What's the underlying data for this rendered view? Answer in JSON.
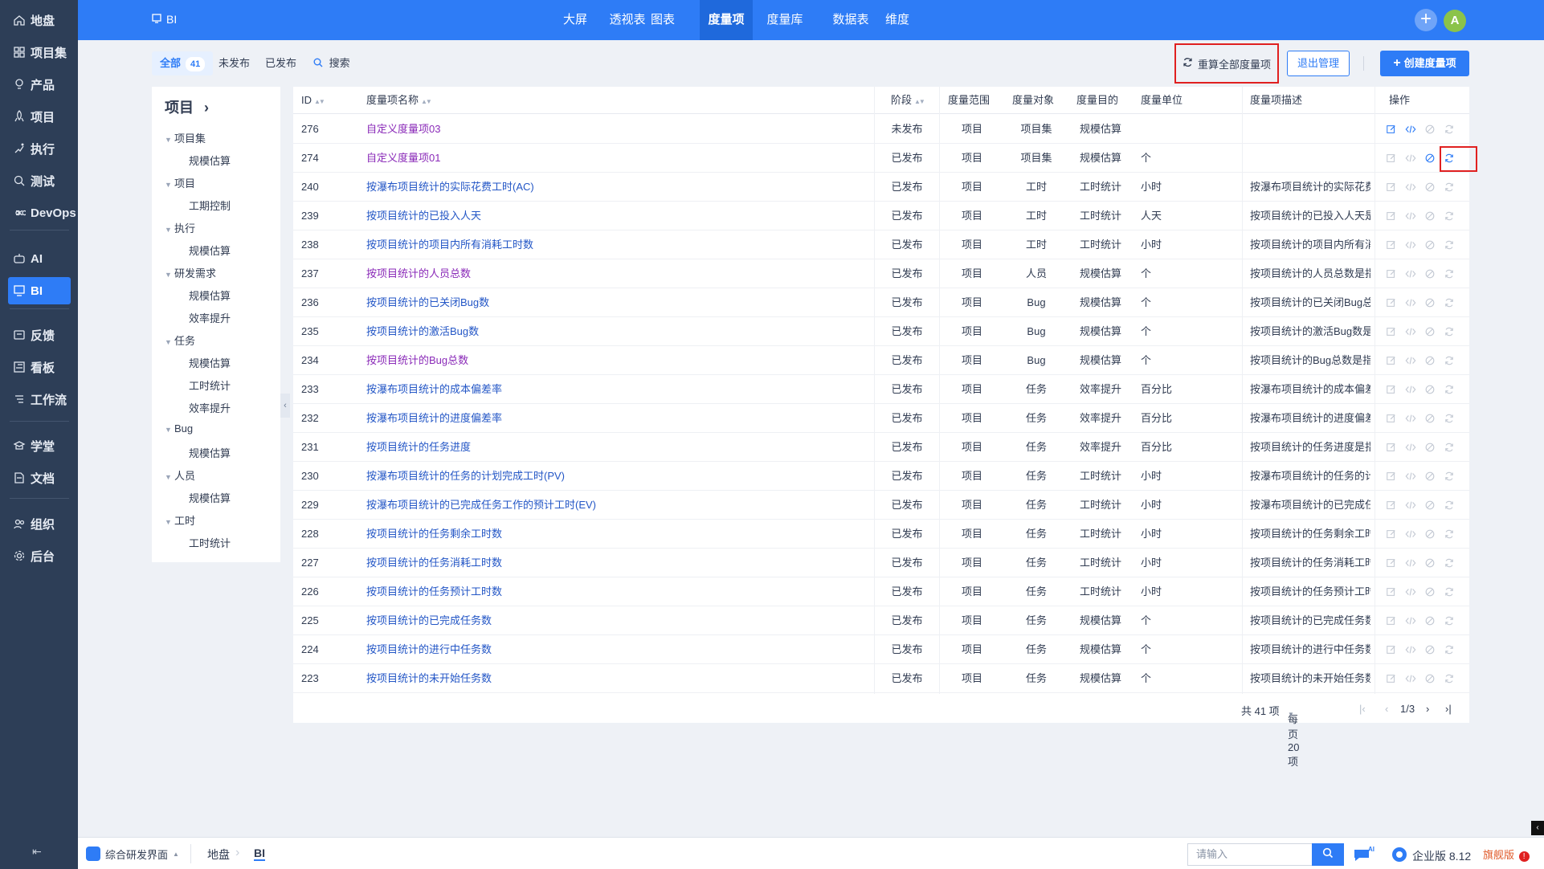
{
  "nav": {
    "items": [
      {
        "label": "地盘",
        "icon": "home-icon"
      },
      {
        "label": "项目集",
        "icon": "grid-icon"
      },
      {
        "label": "产品",
        "icon": "lightbulb-icon"
      },
      {
        "label": "项目",
        "icon": "rocket-icon"
      },
      {
        "label": "执行",
        "icon": "run-icon"
      },
      {
        "label": "测试",
        "icon": "search-icon"
      },
      {
        "label": "DevOps",
        "icon": "infinity-icon"
      },
      {
        "label": "AI",
        "icon": "robot-icon"
      },
      {
        "label": "BI",
        "icon": "chart-icon"
      },
      {
        "label": "反馈",
        "icon": "feedback-icon"
      },
      {
        "label": "看板",
        "icon": "kanban-icon"
      },
      {
        "label": "工作流",
        "icon": "workflow-icon"
      },
      {
        "label": "学堂",
        "icon": "school-icon"
      },
      {
        "label": "文档",
        "icon": "doc-icon"
      },
      {
        "label": "组织",
        "icon": "people-icon"
      },
      {
        "label": "后台",
        "icon": "gear-icon"
      }
    ],
    "active": "BI",
    "collapse": "⇤"
  },
  "header": {
    "app_title": "BI",
    "tabs": [
      "大屏",
      "透视表",
      "图表",
      "度量项",
      "度量库",
      "数据表",
      "维度"
    ],
    "active_tab": "度量项",
    "avatar": "A",
    "plus": "+"
  },
  "toolbar": {
    "tabs": [
      {
        "label": "全部",
        "count": "41"
      },
      {
        "label": "未发布"
      },
      {
        "label": "已发布"
      }
    ],
    "search": "搜索",
    "recalc": "重算全部度量项",
    "exit": "退出管理",
    "create": "创建度量项"
  },
  "tree": {
    "title": "项目",
    "arrow": "›",
    "groups": [
      {
        "label": "项目集",
        "children": [
          "规模估算"
        ]
      },
      {
        "label": "项目",
        "children": [
          "工期控制"
        ]
      },
      {
        "label": "执行",
        "children": [
          "规模估算"
        ]
      },
      {
        "label": "研发需求",
        "children": [
          "规模估算",
          "效率提升"
        ]
      },
      {
        "label": "任务",
        "children": [
          "规模估算",
          "工时统计",
          "效率提升"
        ]
      },
      {
        "label": "Bug",
        "children": [
          "规模估算"
        ]
      },
      {
        "label": "人员",
        "children": [
          "规模估算"
        ]
      },
      {
        "label": "工时",
        "children": [
          "工时统计"
        ]
      }
    ]
  },
  "table": {
    "columns": [
      "ID",
      "度量项名称",
      "阶段",
      "度量范围",
      "度量对象",
      "度量目的",
      "度量单位",
      "度量项描述",
      "操作"
    ],
    "rows": [
      {
        "id": "276",
        "name": "自定义度量项03",
        "visited": true,
        "stage": "未发布",
        "scope": "项目",
        "object": "项目集",
        "purpose": "规模估算",
        "unit": "",
        "desc": ""
      },
      {
        "id": "274",
        "name": "自定义度量项01",
        "visited": true,
        "stage": "已发布",
        "scope": "项目",
        "object": "项目集",
        "purpose": "规模估算",
        "unit": "个",
        "desc": ""
      },
      {
        "id": "240",
        "name": "按瀑布项目统计的实际花费工时(AC)",
        "stage": "已发布",
        "scope": "项目",
        "object": "工时",
        "purpose": "工时统计",
        "unit": "小时",
        "desc": "按瀑布项目统计的实际花费"
      },
      {
        "id": "239",
        "name": "按项目统计的已投入人天",
        "stage": "已发布",
        "scope": "项目",
        "object": "工时",
        "purpose": "工时统计",
        "unit": "人天",
        "desc": "按项目统计的已投入人天是"
      },
      {
        "id": "238",
        "name": "按项目统计的项目内所有消耗工时数",
        "stage": "已发布",
        "scope": "项目",
        "object": "工时",
        "purpose": "工时统计",
        "unit": "小时",
        "desc": "按项目统计的项目内所有消"
      },
      {
        "id": "237",
        "name": "按项目统计的人员总数",
        "visited": true,
        "stage": "已发布",
        "scope": "项目",
        "object": "人员",
        "purpose": "规模估算",
        "unit": "个",
        "desc": "按项目统计的人员总数是指"
      },
      {
        "id": "236",
        "name": "按项目统计的已关闭Bug数",
        "stage": "已发布",
        "scope": "项目",
        "object": "Bug",
        "purpose": "规模估算",
        "unit": "个",
        "desc": "按项目统计的已关闭Bug总"
      },
      {
        "id": "235",
        "name": "按项目统计的激活Bug数",
        "stage": "已发布",
        "scope": "项目",
        "object": "Bug",
        "purpose": "规模估算",
        "unit": "个",
        "desc": "按项目统计的激活Bug数是"
      },
      {
        "id": "234",
        "name": "按项目统计的Bug总数",
        "visited": true,
        "stage": "已发布",
        "scope": "项目",
        "object": "Bug",
        "purpose": "规模估算",
        "unit": "个",
        "desc": "按项目统计的Bug总数是指"
      },
      {
        "id": "233",
        "name": "按瀑布项目统计的成本偏差率",
        "stage": "已发布",
        "scope": "项目",
        "object": "任务",
        "purpose": "效率提升",
        "unit": "百分比",
        "desc": "按瀑布项目统计的成本偏差"
      },
      {
        "id": "232",
        "name": "按瀑布项目统计的进度偏差率",
        "stage": "已发布",
        "scope": "项目",
        "object": "任务",
        "purpose": "效率提升",
        "unit": "百分比",
        "desc": "按瀑布项目统计的进度偏差"
      },
      {
        "id": "231",
        "name": "按项目统计的任务进度",
        "stage": "已发布",
        "scope": "项目",
        "object": "任务",
        "purpose": "效率提升",
        "unit": "百分比",
        "desc": "按项目统计的任务进度是指"
      },
      {
        "id": "230",
        "name": "按瀑布项目统计的任务的计划完成工时(PV)",
        "stage": "已发布",
        "scope": "项目",
        "object": "任务",
        "purpose": "工时统计",
        "unit": "小时",
        "desc": "按瀑布项目统计的任务的计"
      },
      {
        "id": "229",
        "name": "按瀑布项目统计的已完成任务工作的预计工时(EV)",
        "stage": "已发布",
        "scope": "项目",
        "object": "任务",
        "purpose": "工时统计",
        "unit": "小时",
        "desc": "按瀑布项目统计的已完成任"
      },
      {
        "id": "228",
        "name": "按项目统计的任务剩余工时数",
        "stage": "已发布",
        "scope": "项目",
        "object": "任务",
        "purpose": "工时统计",
        "unit": "小时",
        "desc": "按项目统计的任务剩余工时"
      },
      {
        "id": "227",
        "name": "按项目统计的任务消耗工时数",
        "stage": "已发布",
        "scope": "项目",
        "object": "任务",
        "purpose": "工时统计",
        "unit": "小时",
        "desc": "按项目统计的任务消耗工时"
      },
      {
        "id": "226",
        "name": "按项目统计的任务预计工时数",
        "stage": "已发布",
        "scope": "项目",
        "object": "任务",
        "purpose": "工时统计",
        "unit": "小时",
        "desc": "按项目统计的任务预计工时"
      },
      {
        "id": "225",
        "name": "按项目统计的已完成任务数",
        "stage": "已发布",
        "scope": "项目",
        "object": "任务",
        "purpose": "规模估算",
        "unit": "个",
        "desc": "按项目统计的已完成任务数"
      },
      {
        "id": "224",
        "name": "按项目统计的进行中任务数",
        "stage": "已发布",
        "scope": "项目",
        "object": "任务",
        "purpose": "规模估算",
        "unit": "个",
        "desc": "按项目统计的进行中任务数"
      },
      {
        "id": "223",
        "name": "按项目统计的未开始任务数",
        "stage": "已发布",
        "scope": "项目",
        "object": "任务",
        "purpose": "规模估算",
        "unit": "个",
        "desc": "按项目统计的未开始任务数"
      }
    ]
  },
  "pager": {
    "total": "共 41 项",
    "per_page": "每页 20 项",
    "page": "1/3",
    "first": "|‹",
    "prev": "‹",
    "next": "›",
    "last": "›|"
  },
  "bottom": {
    "app": "综合研发界面",
    "crumbs": [
      "地盘",
      "BI"
    ],
    "search_placeholder": "请输入",
    "version": "企业版 8.12",
    "flag": "旗舰版"
  },
  "colors": {
    "primary": "#2e7cf6",
    "nav_bg": "#2d3e57",
    "link": "#2356c6",
    "visited": "#8a2ab8",
    "highlight": "#e02020"
  }
}
